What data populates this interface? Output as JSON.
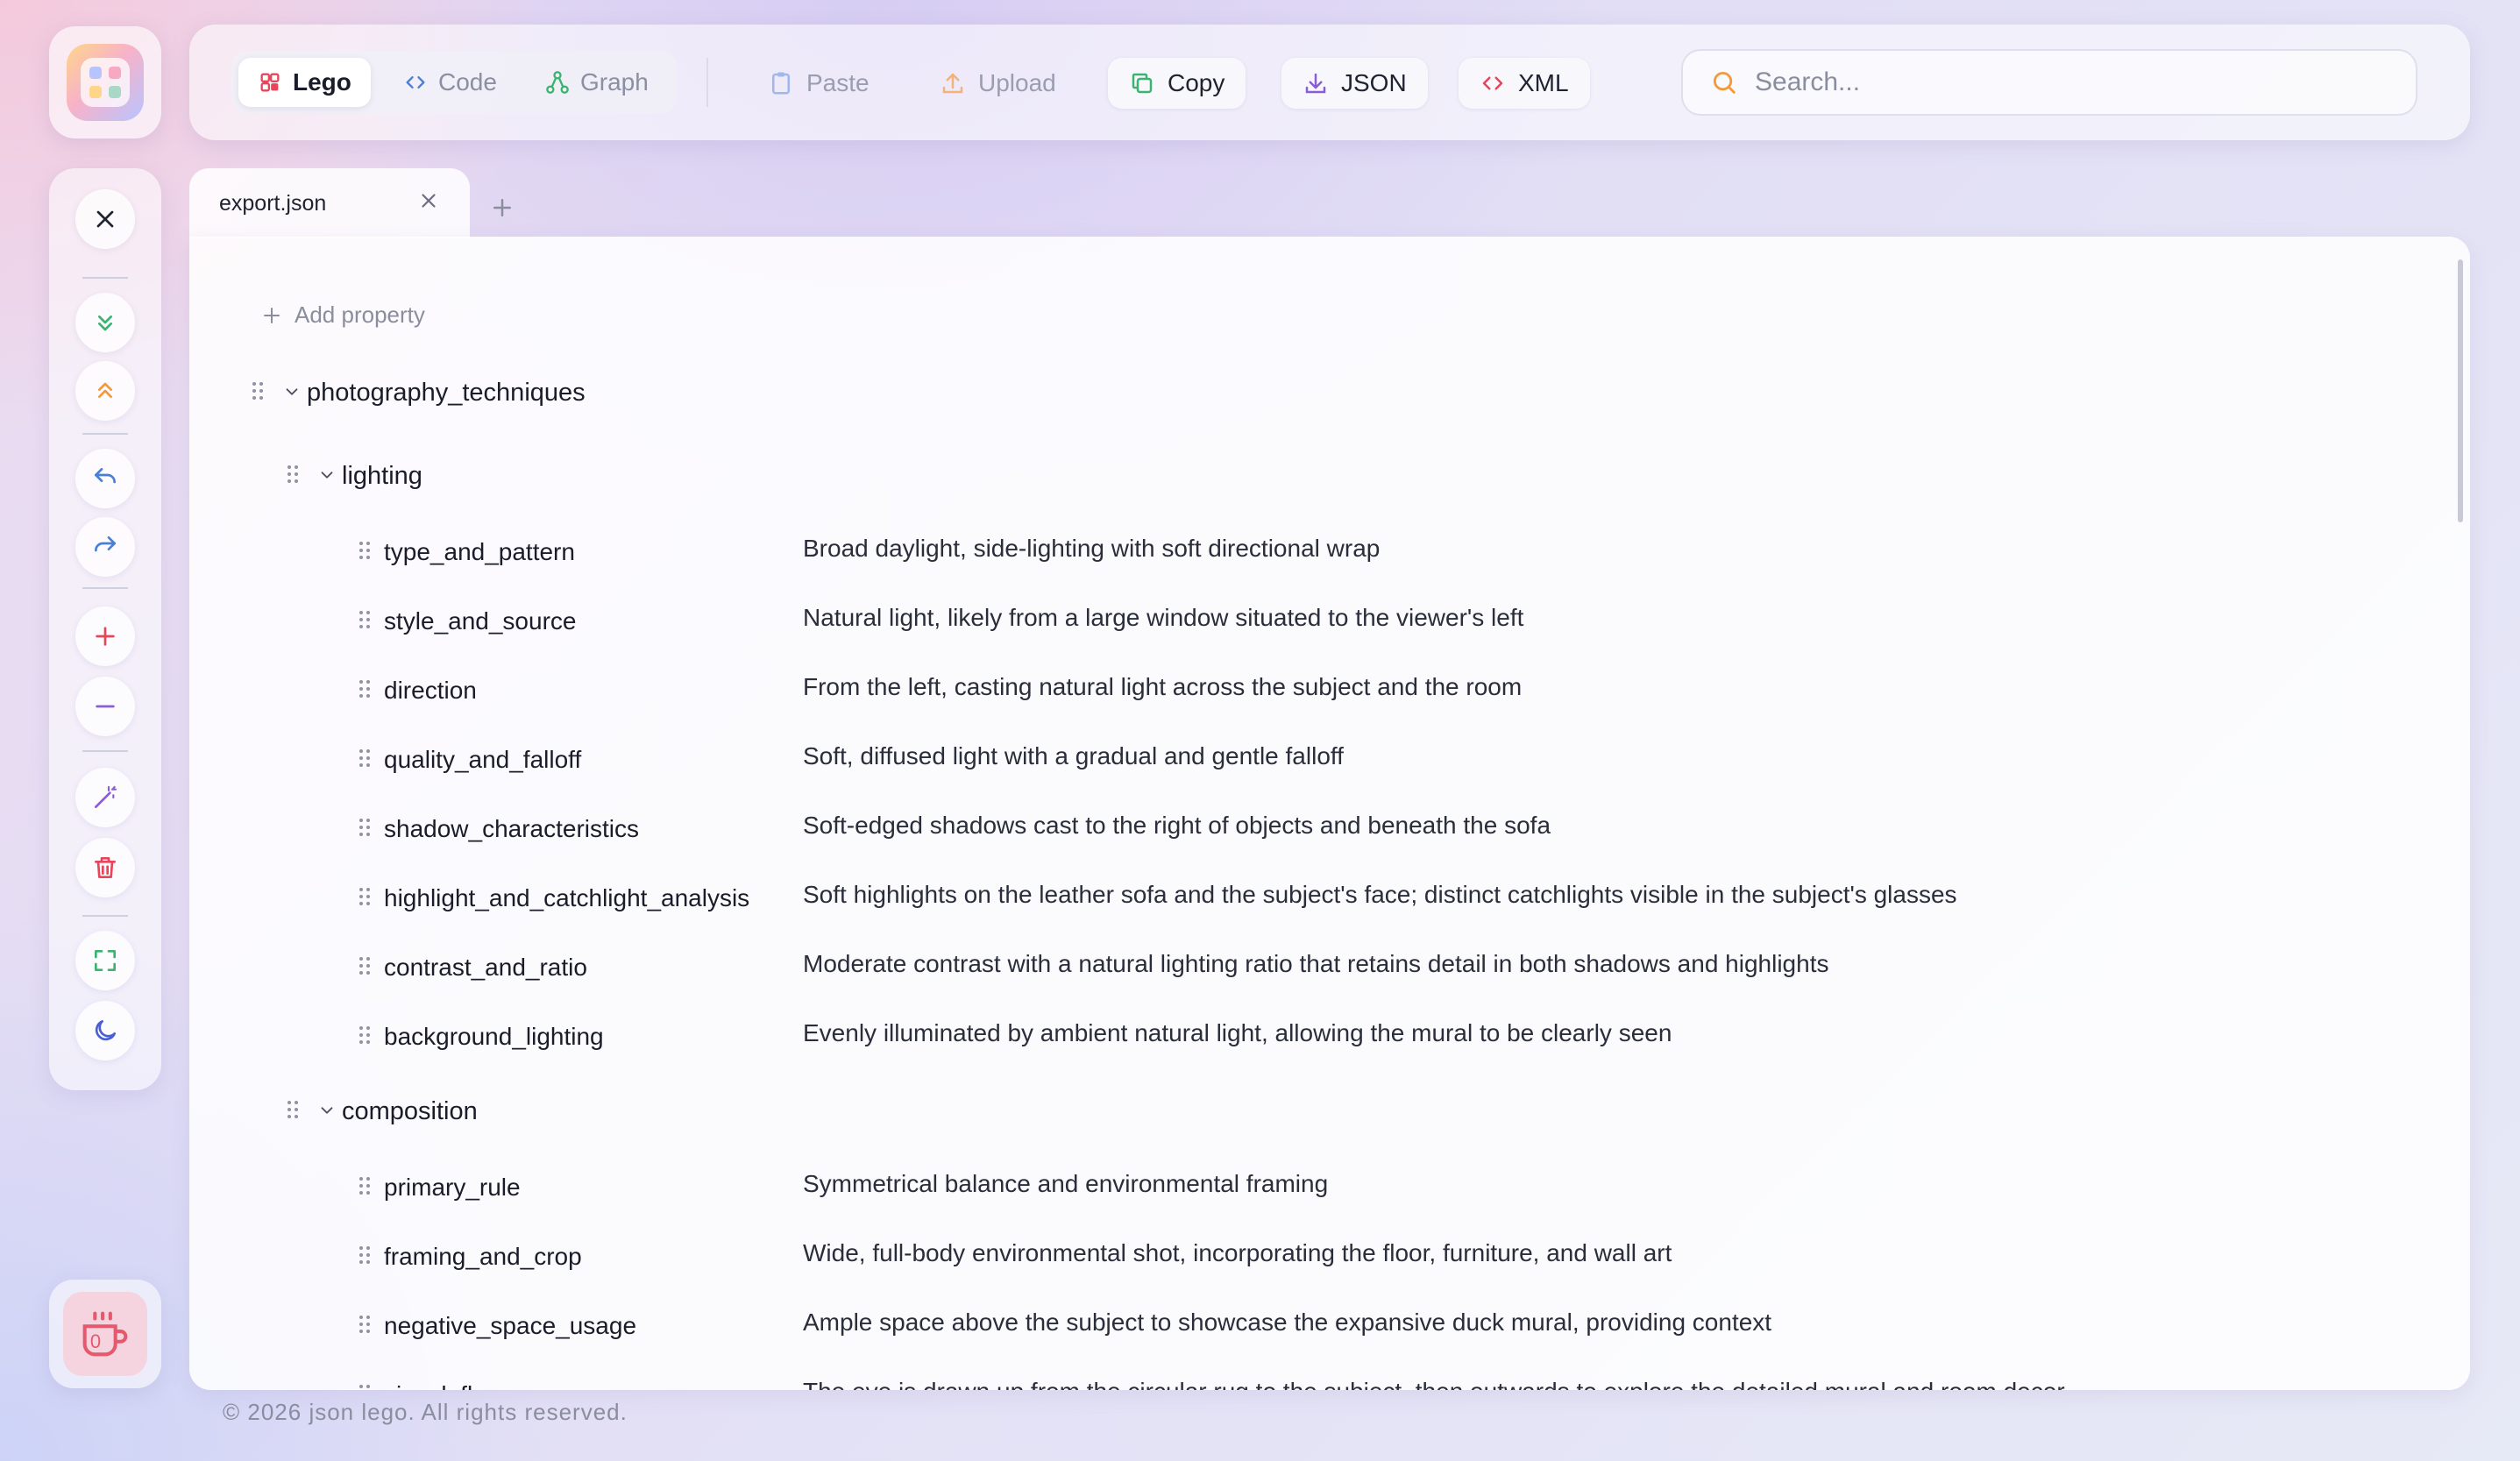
{
  "toolbar": {
    "modes": [
      {
        "label": "Lego",
        "icon": "lego-icon",
        "active": true
      },
      {
        "label": "Code",
        "icon": "code-icon",
        "active": false
      },
      {
        "label": "Graph",
        "icon": "graph-icon",
        "active": false
      }
    ],
    "actions": [
      {
        "label": "Paste",
        "icon": "paste-icon"
      },
      {
        "label": "Upload",
        "icon": "upload-icon"
      },
      {
        "label": "Copy",
        "icon": "copy-icon"
      },
      {
        "label": "JSON",
        "icon": "download-json-icon"
      },
      {
        "label": "XML",
        "icon": "xml-icon"
      }
    ],
    "search_placeholder": "Search..."
  },
  "sidebar": {
    "buttons": [
      "close-icon",
      "expand-all-icon",
      "collapse-all-icon",
      "undo-icon",
      "redo-icon",
      "zoom-in-icon",
      "zoom-out-icon",
      "magic-wand-icon",
      "trash-icon",
      "fullscreen-icon",
      "dark-mode-icon"
    ],
    "coffee_count": "0"
  },
  "tabs": [
    {
      "label": "export.json"
    }
  ],
  "editor": {
    "add_property_label": "Add property",
    "root_key": "photography_techniques",
    "groups": [
      {
        "key": "lighting",
        "properties": [
          {
            "key": "type_and_pattern",
            "value": "Broad daylight, side-lighting with soft directional wrap"
          },
          {
            "key": "style_and_source",
            "value": "Natural light, likely from a large window situated to the viewer's left"
          },
          {
            "key": "direction",
            "value": "From the left, casting natural light across the subject and the room"
          },
          {
            "key": "quality_and_falloff",
            "value": "Soft, diffused light with a gradual and gentle falloff"
          },
          {
            "key": "shadow_characteristics",
            "value": "Soft-edged shadows cast to the right of objects and beneath the sofa"
          },
          {
            "key": "highlight_and_catchlight_analysis",
            "value": "Soft highlights on the leather sofa and the subject's face; distinct catchlights visible in the subject's glasses"
          },
          {
            "key": "contrast_and_ratio",
            "value": "Moderate contrast with a natural lighting ratio that retains detail in both shadows and highlights"
          },
          {
            "key": "background_lighting",
            "value": "Evenly illuminated by ambient natural light, allowing the mural to be clearly seen"
          }
        ]
      },
      {
        "key": "composition",
        "properties": [
          {
            "key": "primary_rule",
            "value": "Symmetrical balance and environmental framing"
          },
          {
            "key": "framing_and_crop",
            "value": "Wide, full-body environmental shot, incorporating the floor, furniture, and wall art"
          },
          {
            "key": "negative_space_usage",
            "value": "Ample space above the subject to showcase the expansive duck mural, providing context"
          },
          {
            "key": "visual_flow",
            "value": "The eye is drawn up from the circular rug to the subject, then outwards to explore the detailed mural and room decor"
          }
        ]
      }
    ]
  },
  "footer": {
    "text": "© 2026 json lego. All rights reserved."
  },
  "colors": {
    "accent_red": "#e8445a",
    "accent_green": "#3cb371",
    "accent_orange": "#f29a3a",
    "accent_blue": "#4a7fd6",
    "accent_purple": "#8a5cd6"
  }
}
